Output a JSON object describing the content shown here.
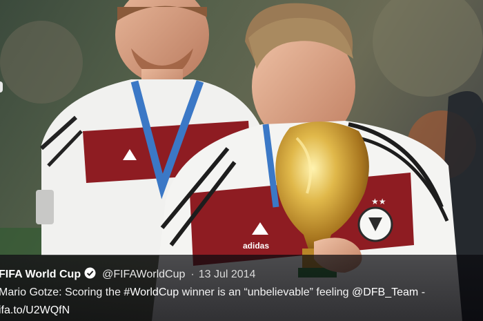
{
  "tweet": {
    "author_name": "FIFA World Cup",
    "verified_icon": "verified-badge-icon",
    "handle": "@FIFAWorldCup",
    "separator": "·",
    "date": "13 Jul 2014",
    "text_prefix": "Mario Gotze: Scoring the ",
    "hashtag": "#WorldCup",
    "text_middle": " winner is an “unbelievable” feeling ",
    "mention": "@DFB_Team",
    "text_suffix": " -",
    "link": "ifa.to/U2WQfN"
  },
  "photo": {
    "subject": "photo",
    "brand_left": "adidas",
    "brand_right": "adidas"
  },
  "colors": {
    "overlay": "#0a0a0e",
    "jersey_white": "#f4f4f2",
    "jersey_red": "#8e1c22",
    "lanyard_blue": "#3b78c6",
    "trophy_gold": "#c9a23a"
  }
}
